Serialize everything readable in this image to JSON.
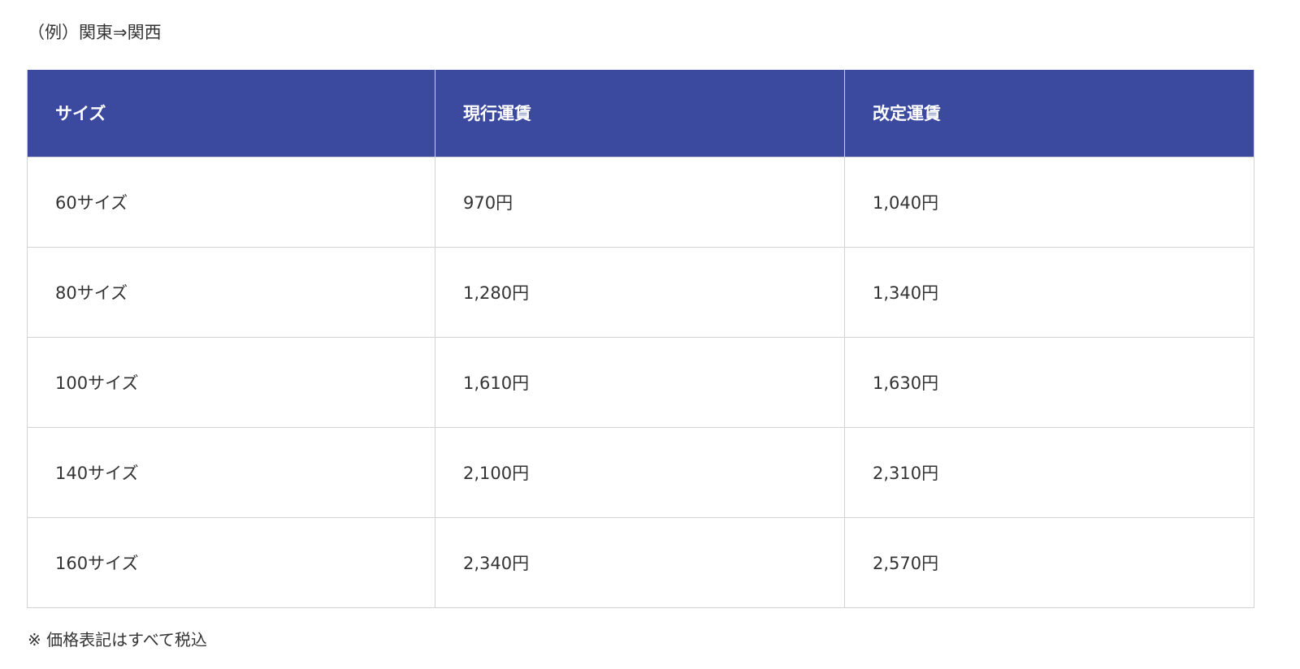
{
  "example_label": "（例）関東⇒関西",
  "table": {
    "headers": [
      "サイズ",
      "現行運賃",
      "改定運賃"
    ],
    "rows": [
      [
        "60サイズ",
        "970円",
        "1,040円"
      ],
      [
        "80サイズ",
        "1,280円",
        "1,340円"
      ],
      [
        "100サイズ",
        "1,610円",
        "1,630円"
      ],
      [
        "140サイズ",
        "2,100円",
        "2,310円"
      ],
      [
        "160サイズ",
        "2,340円",
        "2,570円"
      ]
    ]
  },
  "footnote": "※ 価格表記はすべて税込",
  "colors": {
    "header_bg": "#3b4a9e",
    "header_text": "#ffffff",
    "border": "#d3d3d3"
  }
}
